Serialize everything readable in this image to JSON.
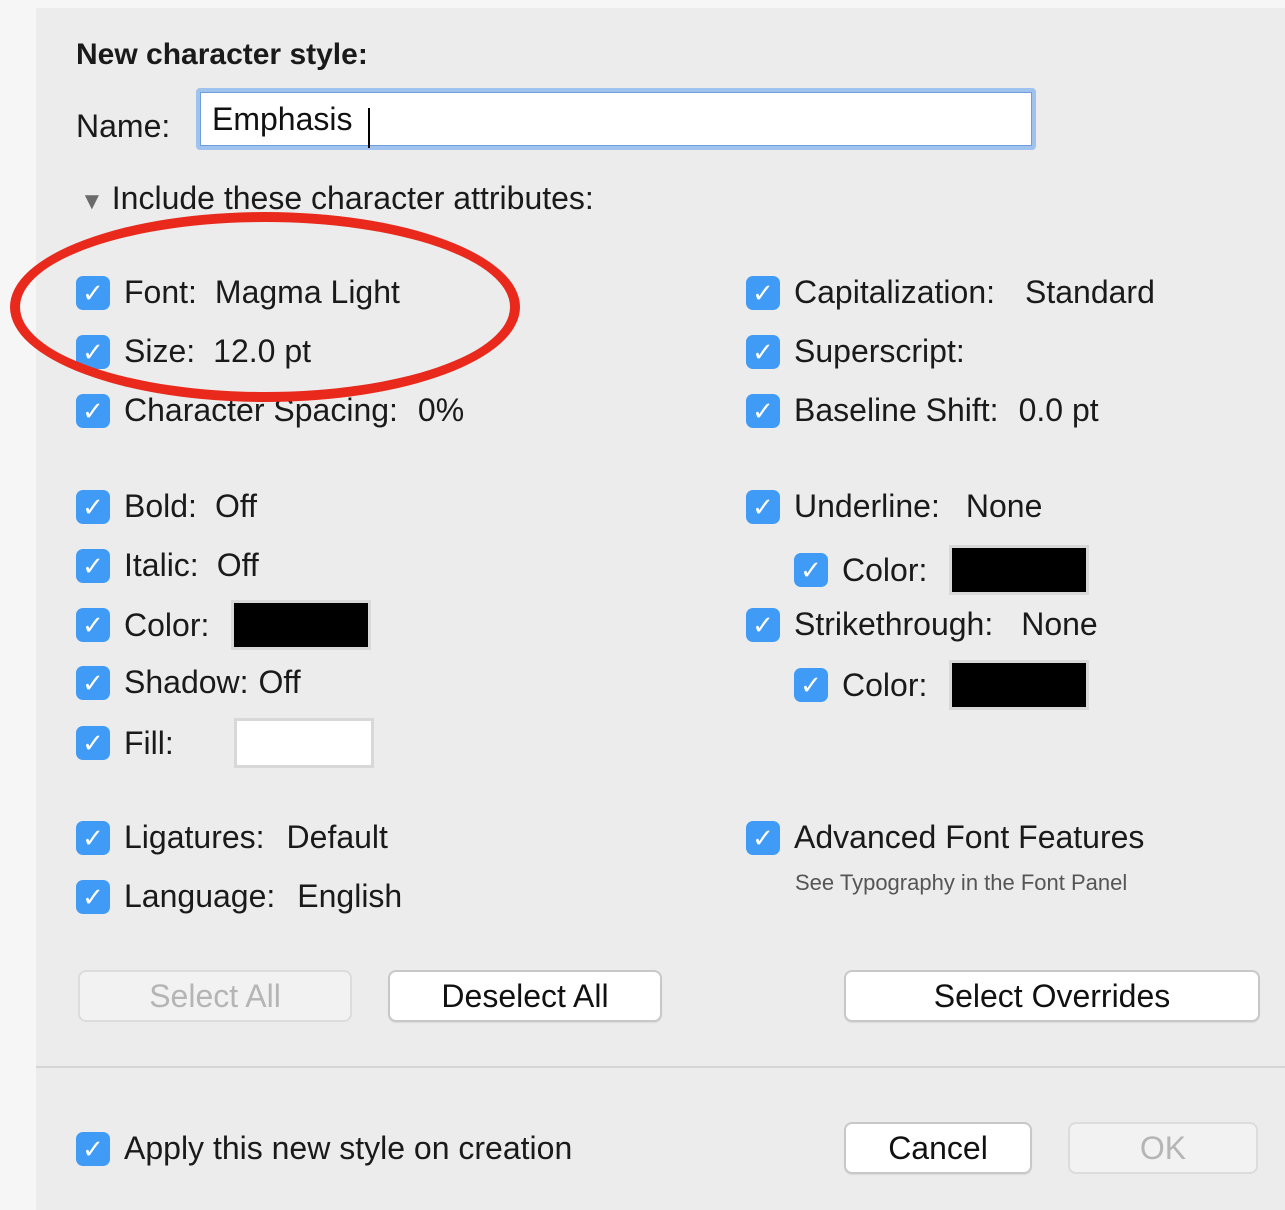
{
  "dialog": {
    "title": "New character style:",
    "name_label": "Name:",
    "name_value": "Emphasis",
    "section_label": "Include these character attributes:"
  },
  "left": {
    "font": {
      "label": "Font:",
      "value": "Magma Light"
    },
    "size": {
      "label": "Size:",
      "value": "12.0 pt"
    },
    "spacing": {
      "label": "Character Spacing:",
      "value": "0%"
    },
    "bold": {
      "label": "Bold:",
      "value": "Off"
    },
    "italic": {
      "label": "Italic:",
      "value": "Off"
    },
    "color": {
      "label": "Color:",
      "swatch": "#000000"
    },
    "shadow": {
      "label": "Shadow:",
      "value": "Off"
    },
    "fill": {
      "label": "Fill:",
      "swatch": "#ffffff"
    },
    "ligatures": {
      "label": "Ligatures:",
      "value": "Default"
    },
    "language": {
      "label": "Language:",
      "value": "English"
    }
  },
  "right": {
    "capitalization": {
      "label": "Capitalization:",
      "value": "Standard"
    },
    "superscript": {
      "label": "Superscript:"
    },
    "baseline": {
      "label": "Baseline Shift:",
      "value": "0.0 pt"
    },
    "underline": {
      "label": "Underline:",
      "value": "None"
    },
    "underline_color": {
      "label": "Color:",
      "swatch": "#000000"
    },
    "strike": {
      "label": "Strikethrough:",
      "value": "None"
    },
    "strike_color": {
      "label": "Color:",
      "swatch": "#000000"
    },
    "advanced": {
      "label": "Advanced Font Features",
      "note": "See Typography in the Font Panel"
    }
  },
  "buttons": {
    "select_all": "Select All",
    "deselect_all": "Deselect All",
    "select_overrides": "Select Overrides",
    "cancel": "Cancel",
    "ok": "OK"
  },
  "footer": {
    "apply_label": "Apply this new style on creation"
  },
  "colors": {
    "checkbox": "#3f9bf5",
    "annotation": "#e8291b",
    "focus_ring": "#9fc2ee"
  },
  "icons": {
    "check": "checkmark-icon",
    "disclosure": "disclosure-triangle-icon"
  }
}
